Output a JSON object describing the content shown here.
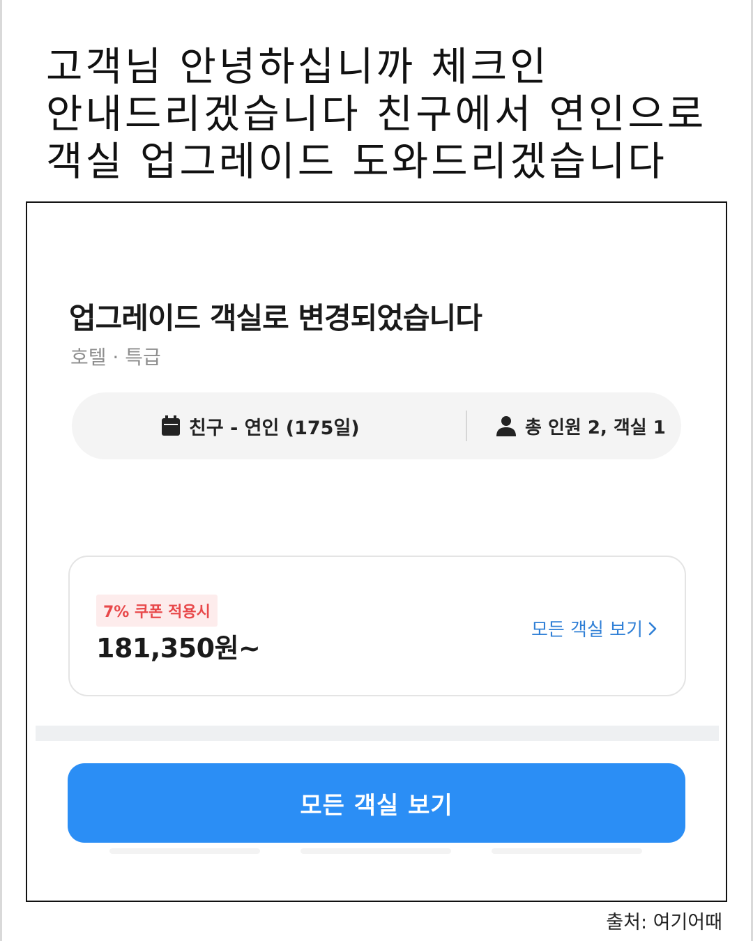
{
  "caption": {
    "lines": [
      "고객님 안녕하십니까 체크인",
      "안내드리겠습니다 친구에서 연인으로",
      "객실 업그레이드 도와드리겠습니다"
    ]
  },
  "screen": {
    "title": "업그레이드 객실로 변경되었습니다",
    "subtitle": "호텔 · 특급",
    "info_bar": {
      "date_icon": "calendar-icon",
      "date_text": "친구 - 연인 (175일)",
      "guest_icon": "person-icon",
      "guest_text": "총 인원 2, 객실 1"
    },
    "price_card": {
      "coupon_badge": "7% 쿠폰 적용시",
      "price": "181,350원~",
      "link_label": "모든 객실 보기",
      "link_icon": "chevron-right-icon"
    },
    "cta_label": "모든 객실 보기"
  },
  "footer": {
    "source": "출처: 여기어때"
  },
  "colors": {
    "accent_blue": "#2b8ef5",
    "link_blue": "#2f7fd6",
    "coupon_red": "#e8484a",
    "coupon_bg": "#fdecec"
  }
}
